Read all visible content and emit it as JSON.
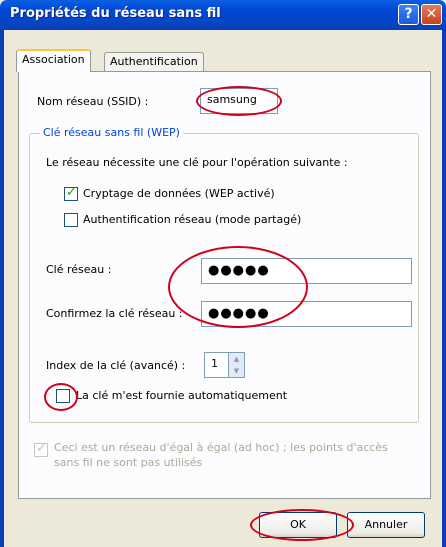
{
  "window": {
    "title": "Propriétés du réseau sans fil",
    "help_glyph": "?",
    "close_glyph": "✕"
  },
  "tabs": [
    {
      "label": "Association",
      "active": true
    },
    {
      "label": "Authentification",
      "active": false
    }
  ],
  "ssid": {
    "label": "Nom réseau (SSID) :",
    "value": "samsung"
  },
  "wep_group": {
    "legend": "Clé réseau sans fil (WEP)",
    "intro": "Le réseau nécessite une clé pour l'opération suivante :",
    "data_encryption": {
      "label": "Cryptage de données (WEP activé)",
      "checked": true
    },
    "network_auth": {
      "label": "Authentification réseau (mode partagé)",
      "checked": false
    },
    "key": {
      "label": "Clé réseau :",
      "value": "●●●●●"
    },
    "confirm_key": {
      "label": "Confirmez la clé réseau :",
      "value": "●●●●●"
    },
    "key_index": {
      "label": "Index de la clé (avancé) :",
      "value": "1"
    },
    "auto_key": {
      "label": "La clé m'est fournie automatiquement",
      "checked": false
    }
  },
  "adhoc": {
    "label_line1": "Ceci est un réseau d'égal à égal (ad hoc) ; les points d'accès",
    "label_line2": "sans fil ne sont pas utilisés",
    "checked": true,
    "disabled": true
  },
  "buttons": {
    "ok": "OK",
    "cancel": "Annuler"
  },
  "colors": {
    "title_bar": "#0046D5",
    "annotation": "#D0021B",
    "dialog_bg": "#ECE9D8"
  }
}
